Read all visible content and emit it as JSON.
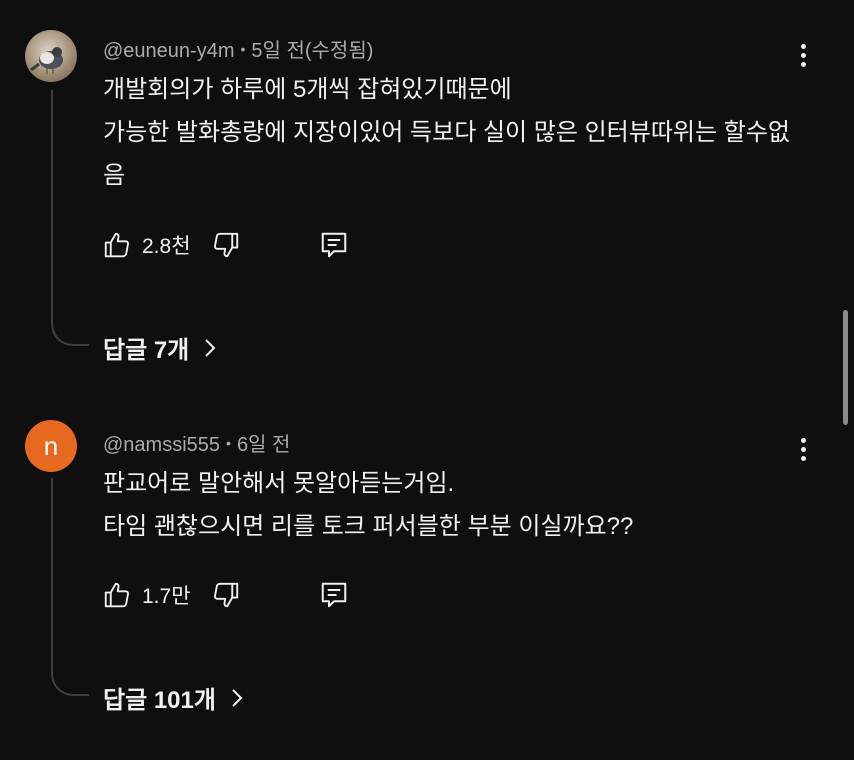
{
  "comments": [
    {
      "handle": "@euneun-y4m",
      "separator": "•",
      "time": "5일 전(수정됨)",
      "avatar_letter": "",
      "text": "개발회의가 하루에 5개씩 잡혀있기때문에\n 가능한 발화총량에 지장이있어 득보다 실이 많은  인터뷰따위는 할수없음",
      "likes": "2.8천",
      "replies_label": "답글 7개"
    },
    {
      "handle": "@namssi555",
      "separator": "•",
      "time": "6일 전",
      "avatar_letter": "n",
      "avatar_color": "#e6691f",
      "text": "판교어로 말안해서 못알아듣는거임.\n타임 괜찮으시면 리를 토크 퍼서블한 부분 이실까요??",
      "likes": "1.7만",
      "replies_label": "답글 101개"
    }
  ],
  "icons": {
    "like": "thumbs-up-icon",
    "dislike": "thumbs-down-icon",
    "reply": "comment-reply-icon",
    "more": "more-vertical-icon",
    "chevron": "chevron-right-icon"
  },
  "colors": {
    "background": "#0f0f0f",
    "text": "#f1f1f1",
    "meta": "#aaaaaa",
    "thread_line": "#3f3f3f"
  }
}
